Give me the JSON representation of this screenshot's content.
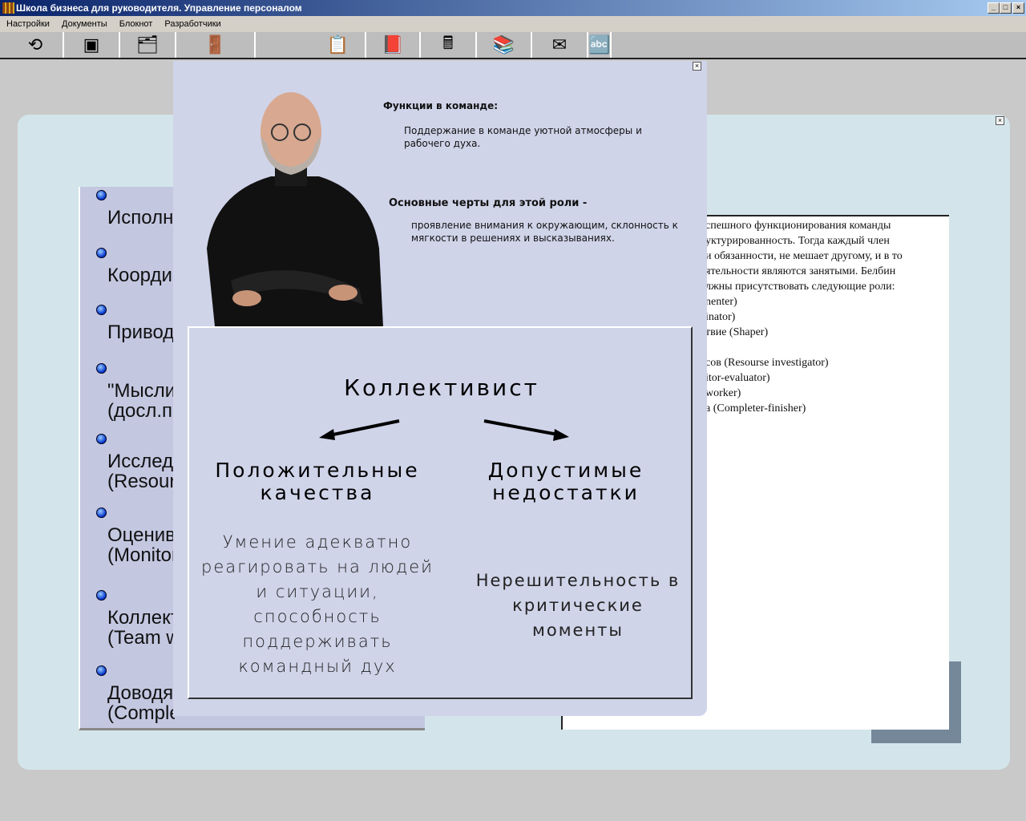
{
  "window": {
    "title": "Школа бизнеса для руководителя. Управление персоналом",
    "min": "_",
    "max": "□",
    "close": "×"
  },
  "menu": [
    "Настройки",
    "Документы",
    "Блокнот",
    "Разработчики"
  ],
  "toolbar": [
    {
      "icon": "logo-icon",
      "glyph": "⟲"
    },
    {
      "icon": "cubes-icon",
      "glyph": "▣"
    },
    {
      "icon": "folders-icon",
      "glyph": "🗂"
    },
    {
      "icon": "exit-door-icon",
      "glyph": "🚪"
    },
    {
      "icon": "clipboard-icon",
      "glyph": "📋"
    },
    {
      "icon": "notebook-icon",
      "glyph": "📕"
    },
    {
      "icon": "calculator-icon",
      "glyph": "🖩"
    },
    {
      "icon": "books-icon",
      "glyph": "📚"
    },
    {
      "icon": "mail-icon",
      "glyph": "✉"
    },
    {
      "icon": "abc-icon",
      "glyph": "🔤"
    }
  ],
  "roles": [
    [
      "Исполнитель"
    ],
    [
      "Координатор"
    ],
    [
      "Приводящий в движение"
    ],
    [
      "\"Мыслитель\"",
      "(досл.пересадка)"
    ],
    [
      "Исследователь",
      "(Resourse investigator)"
    ],
    [
      "Оценивающий",
      "(Monitor-evaluator)"
    ],
    [
      "Коллективист",
      "(Team worker)"
    ],
    [
      "Доводящий",
      "(Completer-finisher)"
    ]
  ],
  "right_text": [
    "спешного функционирования команды",
    "уктурированность. Тогда каждый член",
    "и обязанности, не мешает другому, и в то",
    "ятельности являются занятыми. Белбин",
    "лжны присутствовать следующие роли:",
    "nenter)",
    "inator)",
    "твие (Shaper)",
    "",
    "сов (Resourse investigator)",
    "itor-evaluator)",
    "worker)",
    "а (Completer-finisher)"
  ],
  "popup": {
    "functions_title": "Функции в команде:",
    "functions_text": "Поддержание в команде уютной атмосферы и рабочего духа.",
    "traits_title": "Основные черты для этой роли -",
    "traits_text": "проявление внимания к окружающим, склонность к мягкости в решениях и высказываниях.",
    "role_name": "Коллективист",
    "positive_title": "Положительные качества",
    "positive_text": "Умение адекватно реагировать на людей и ситуации, способность поддерживать командный дух",
    "negative_title": "Допустимые недостатки",
    "negative_text": "Нерешительность в критические моменты"
  }
}
